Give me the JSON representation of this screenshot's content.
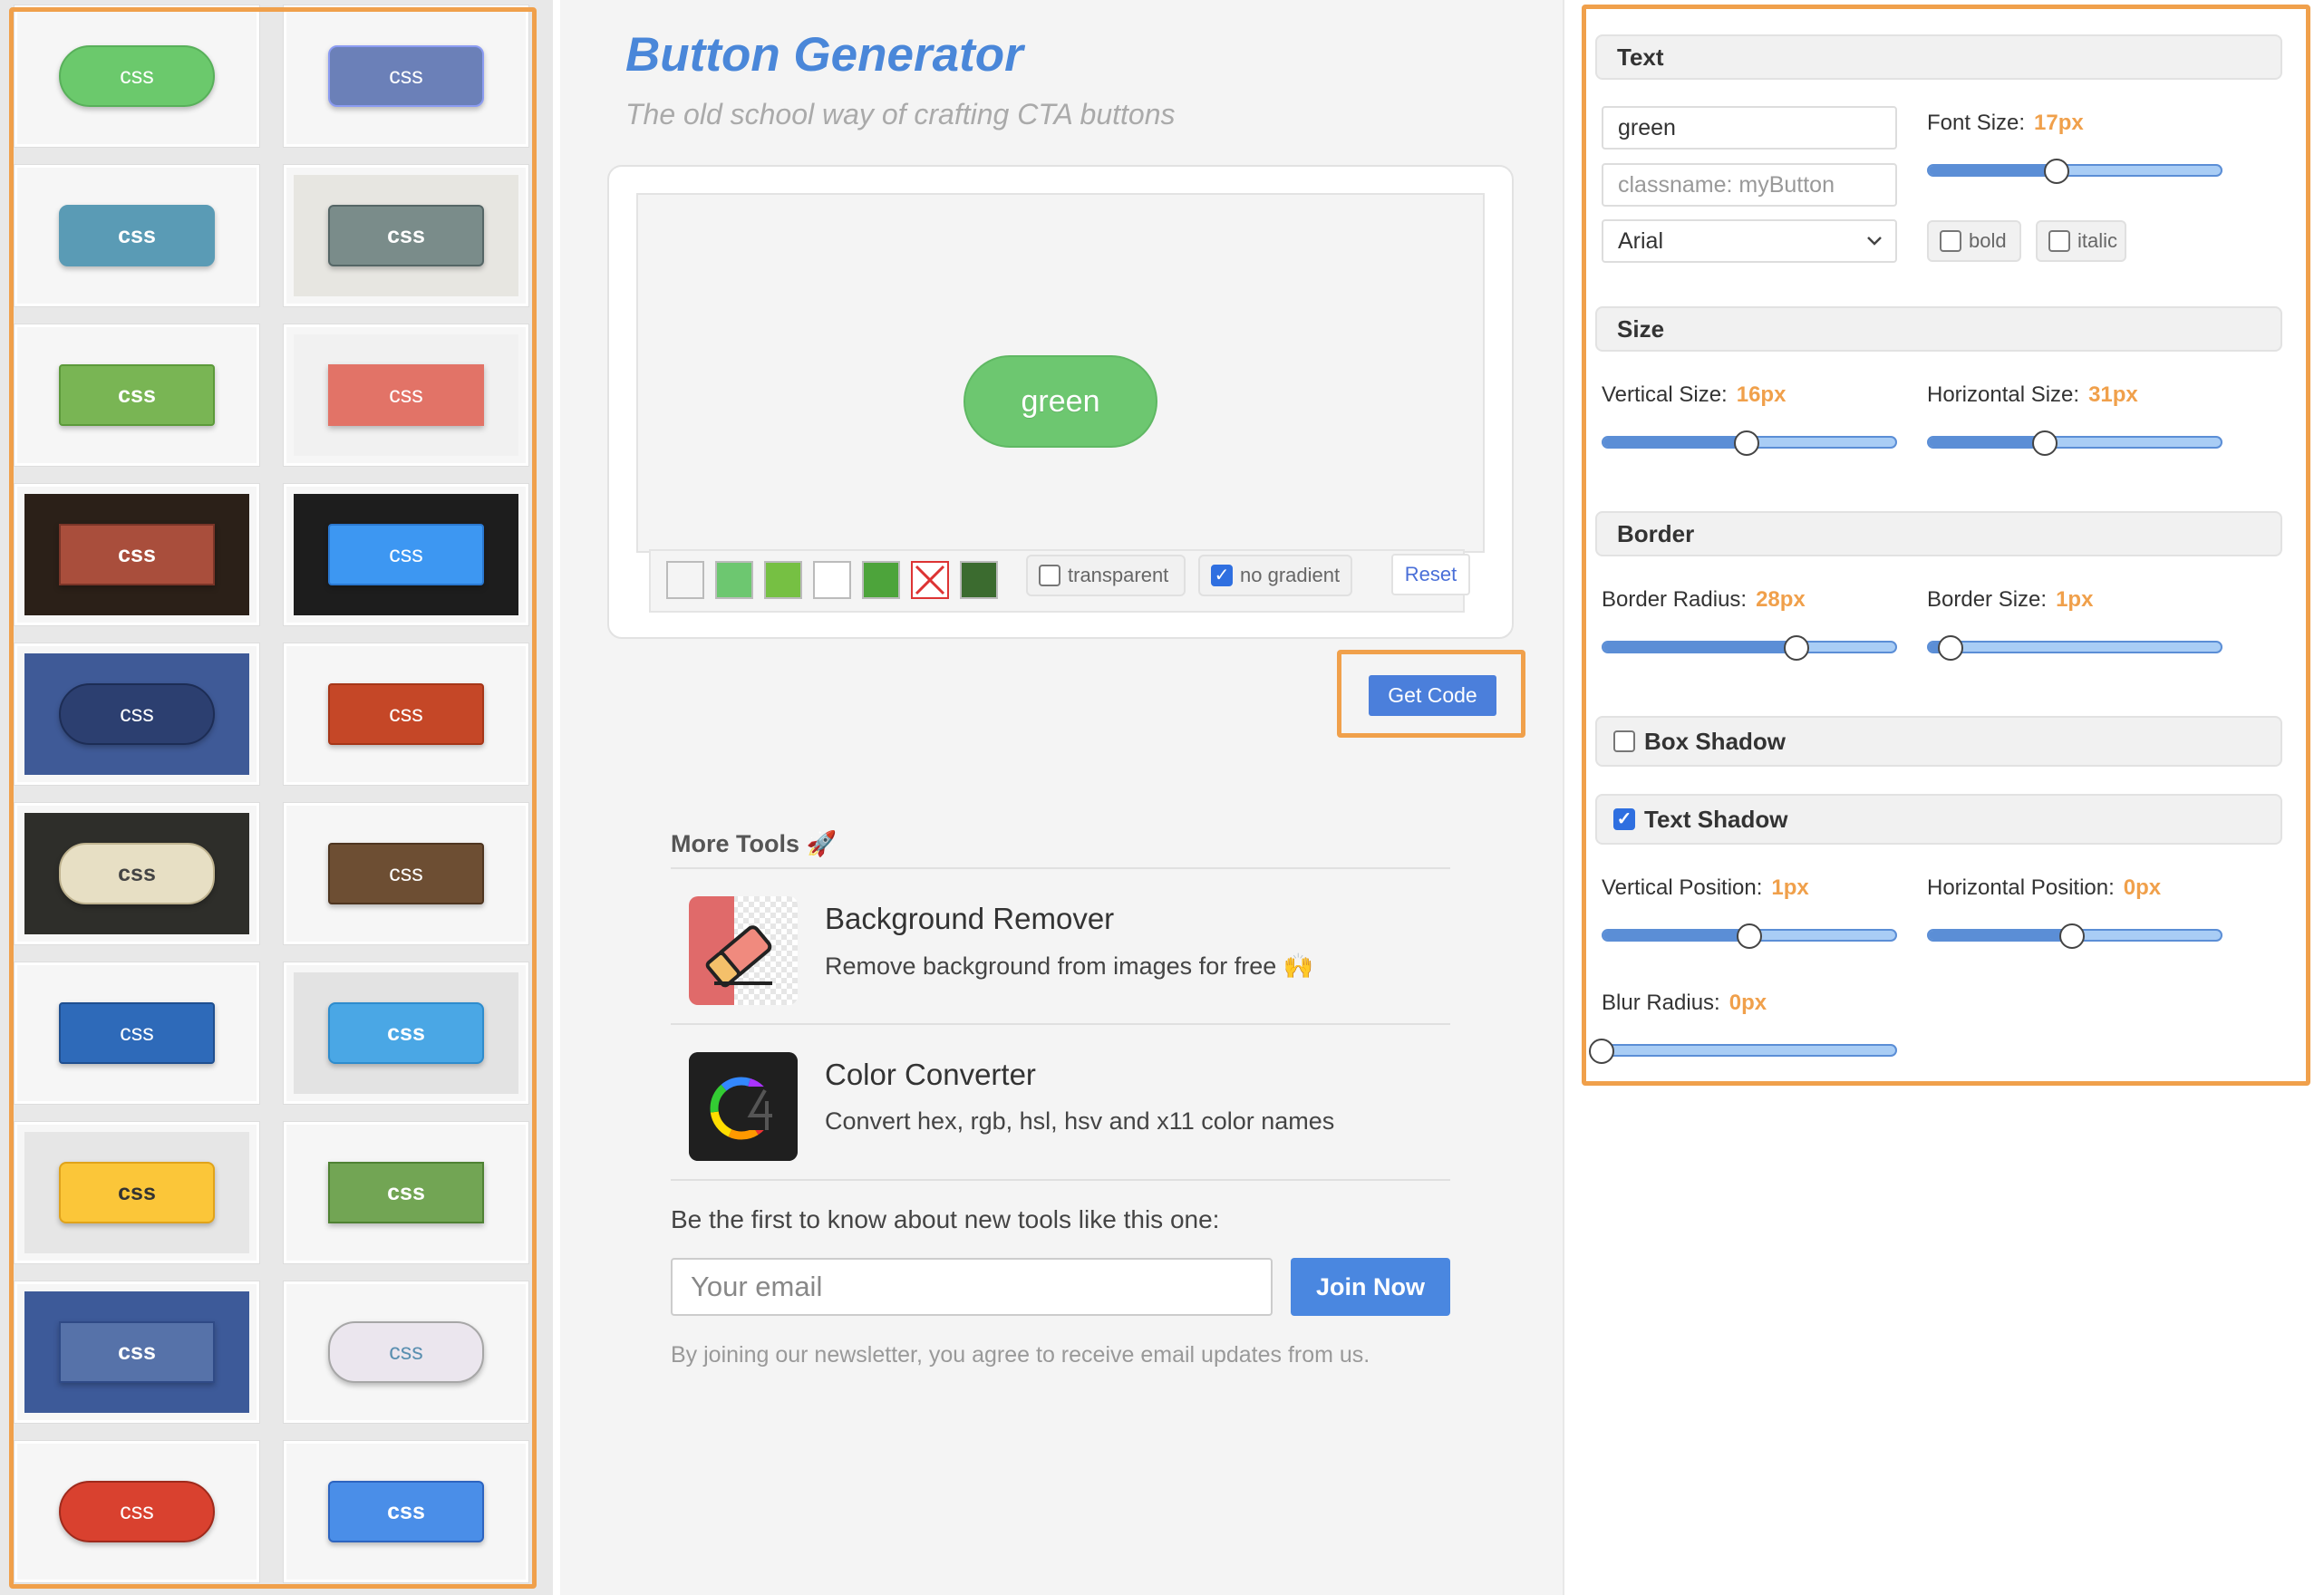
{
  "preset_label": "css",
  "presets": [
    {
      "bg": "#f6f6f6",
      "fill": "#6bc96c",
      "border": "#58b05a",
      "radius": "34px",
      "color": "#fff",
      "weight": "normal"
    },
    {
      "bg": "#f6f6f6",
      "fill": "#6b80b8",
      "border": "#8c9cf2",
      "radius": "10px",
      "color": "#fff",
      "weight": "normal"
    },
    {
      "bg": "#f6f6f6",
      "fill": "#5a9bb5",
      "border": "#5a9bb5",
      "radius": "10px",
      "color": "#fff",
      "weight": "bold"
    },
    {
      "bg": "#e7e6e1",
      "fill": "#7a8c8a",
      "border": "#566",
      "radius": "6px",
      "color": "#fff",
      "weight": "bold"
    },
    {
      "bg": "#f6f6f6",
      "fill": "#79b554",
      "border": "#5c9a3a",
      "radius": "4px",
      "color": "#fff",
      "weight": "bold"
    },
    {
      "bg": "#f1f1f1",
      "fill": "#e27367",
      "border": "#e27367",
      "radius": "0px",
      "color": "#fff",
      "weight": "normal"
    },
    {
      "bg": "#2b2018",
      "fill": "#a94e3c",
      "border": "#7a3528",
      "radius": "0px",
      "color": "#fff",
      "weight": "bold"
    },
    {
      "bg": "#1d1d1d",
      "fill": "#3d97f2",
      "border": "#2a78d0",
      "radius": "4px",
      "color": "#fff",
      "weight": "normal"
    },
    {
      "bg": "#3f5a97",
      "fill": "#2c3f70",
      "border": "#1d2d55",
      "radius": "34px",
      "color": "#fff",
      "weight": "normal"
    },
    {
      "bg": "#f6f6f6",
      "fill": "#c54727",
      "border": "#a63618",
      "radius": "4px",
      "color": "#fff",
      "weight": "normal"
    },
    {
      "bg": "#2e2e2a",
      "fill": "#e7dfc4",
      "border": "#bfb38f",
      "radius": "30px",
      "color": "#444",
      "weight": "bold"
    },
    {
      "bg": "#f6f6f6",
      "fill": "#6d4e33",
      "border": "#4e3520",
      "radius": "4px",
      "color": "#fff",
      "weight": "normal"
    },
    {
      "bg": "#f6f6f6",
      "fill": "#2e6ab9",
      "border": "#1f4f90",
      "radius": "4px",
      "color": "#fff",
      "weight": "normal"
    },
    {
      "bg": "#e3e3e3",
      "fill": "#4aa7e5",
      "border": "#2e8ccd",
      "radius": "8px",
      "color": "#fff",
      "weight": "bold"
    },
    {
      "bg": "#e6e6e6",
      "fill": "#fbc639",
      "border": "#e0a31b",
      "radius": "8px",
      "color": "#333",
      "weight": "bold"
    },
    {
      "bg": "#f6f6f6",
      "fill": "#72a554",
      "border": "#4f8233",
      "radius": "0px",
      "color": "#fff",
      "weight": "bold"
    },
    {
      "bg": "#3d5a99",
      "fill": "#5672a9",
      "border": "#2f4a86",
      "radius": "0px",
      "color": "#fff",
      "weight": "bold"
    },
    {
      "bg": "#f6f6f6",
      "fill": "#ebe6ee",
      "border": "#a7a7a7",
      "radius": "30px",
      "color": "#5a8fb0",
      "weight": "normal"
    },
    {
      "bg": "#f6f6f6",
      "fill": "#d9412f",
      "border": "#9f2a1c",
      "radius": "34px",
      "color": "#fff",
      "weight": "normal"
    },
    {
      "bg": "#f6f6f6",
      "fill": "#4a8ee8",
      "border": "#2d64c0",
      "radius": "6px",
      "color": "#fff",
      "weight": "bold"
    }
  ],
  "header": {
    "title": "Button Generator",
    "subtitle": "The old school way of crafting CTA buttons"
  },
  "preview": {
    "button_text": "green",
    "swatches": [
      "#f4f4f4",
      "#6dc770",
      "#76c043",
      "#ffffff",
      "#4da43b",
      "none",
      "#3b6b2f"
    ],
    "transparent_label": "transparent",
    "no_gradient_label": "no gradient",
    "reset_label": "Reset"
  },
  "get_code_label": "Get Code",
  "more_tools": {
    "title": "More Tools 🚀",
    "items": [
      {
        "title": "Background Remover",
        "desc": "Remove background from images for free 🙌"
      },
      {
        "title": "Color Converter",
        "desc": "Convert hex, rgb, hsl, hsv and x11 color names"
      }
    ]
  },
  "newsletter": {
    "text": "Be the first to know about new tools like this one:",
    "placeholder": "Your email",
    "join_label": "Join Now",
    "note": "By joining our newsletter, you agree to receive email updates from us."
  },
  "settings": {
    "text_section": "Text",
    "text_value": "green",
    "classname_placeholder": "classname: myButton",
    "font": "Arial",
    "font_size_label": "Font Size:",
    "font_size": "17px",
    "font_size_frac": 0.44,
    "bold_label": "bold",
    "italic_label": "italic",
    "size_section": "Size",
    "vsize_label": "Vertical Size:",
    "vsize": "16px",
    "vsize_frac": 0.49,
    "hsize_label": "Horizontal Size:",
    "hsize": "31px",
    "hsize_frac": 0.4,
    "border_section": "Border",
    "radius_label": "Border Radius:",
    "radius": "28px",
    "radius_frac": 0.66,
    "bsize_label": "Border Size:",
    "bsize": "1px",
    "bsize_frac": 0.08,
    "box_shadow_section": "Box Shadow",
    "text_shadow_section": "Text Shadow",
    "tvpos_label": "Vertical Position:",
    "tvpos": "1px",
    "tvpos_frac": 0.5,
    "thpos_label": "Horizontal Position:",
    "thpos": "0px",
    "thpos_frac": 0.49,
    "blur_label": "Blur Radius:",
    "blur": "0px",
    "blur_frac": 0.0
  }
}
